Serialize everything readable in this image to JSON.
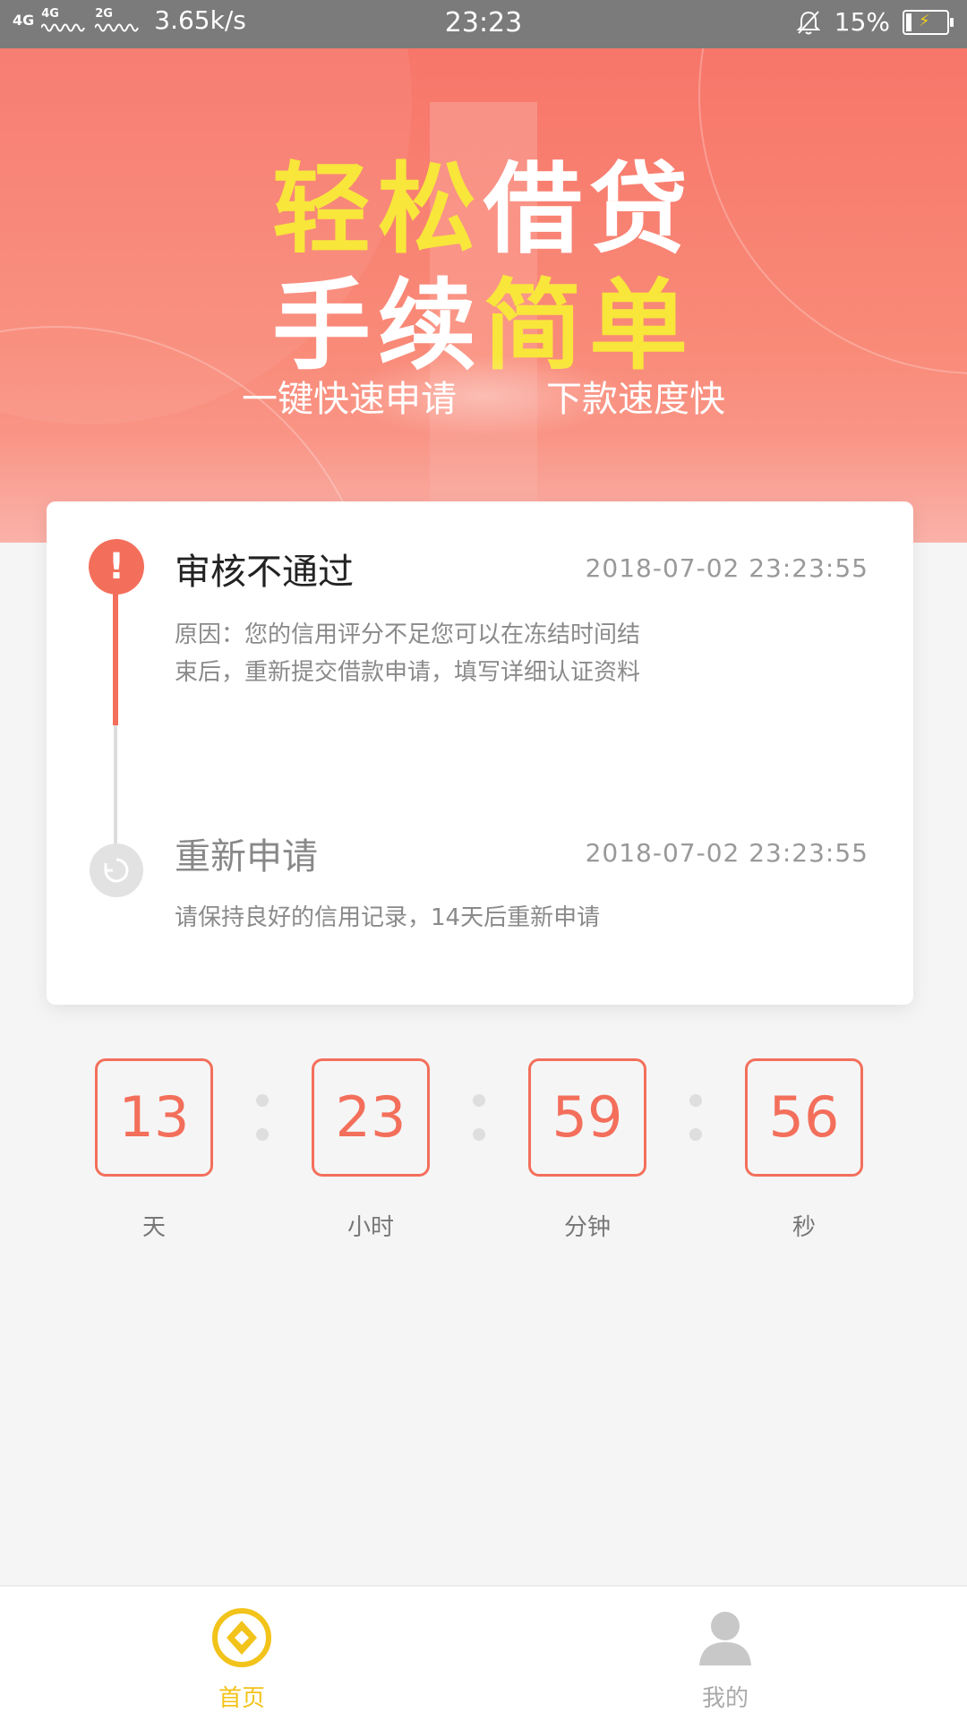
{
  "status_bar": {
    "signal1": "4G",
    "signal1b": "4G",
    "signal2": "2G",
    "speed": "3.65k/s",
    "time": "23:23",
    "battery": "15%"
  },
  "banner": {
    "line1_yellow": "轻松",
    "line1_white": "借贷",
    "line2_white": "手续",
    "line2_yellow": "简单",
    "sub_left": "一键快速申请",
    "sub_right": "下款速度快"
  },
  "status_card": {
    "steps": [
      {
        "title": "审核不通过",
        "time": "2018-07-02 23:23:55",
        "description": "原因：您的信用评分不足您可以在冻结时间结束后，重新提交借款申请，填写详细认证资料"
      },
      {
        "title": "重新申请",
        "time": "2018-07-02 23:23:55",
        "description": "请保持良好的信用记录，14天后重新申请"
      }
    ]
  },
  "countdown": {
    "days": "13",
    "hours": "23",
    "minutes": "59",
    "seconds": "56",
    "label_days": "天",
    "label_hours": "小时",
    "label_minutes": "分钟",
    "label_seconds": "秒"
  },
  "bottom_nav": {
    "home_label": "首页",
    "me_label": "我的"
  },
  "colors": {
    "accent": "#f36f5b",
    "banner": "#f7766a",
    "highlight": "#f8e63b",
    "nav_active": "#f2c31a"
  }
}
